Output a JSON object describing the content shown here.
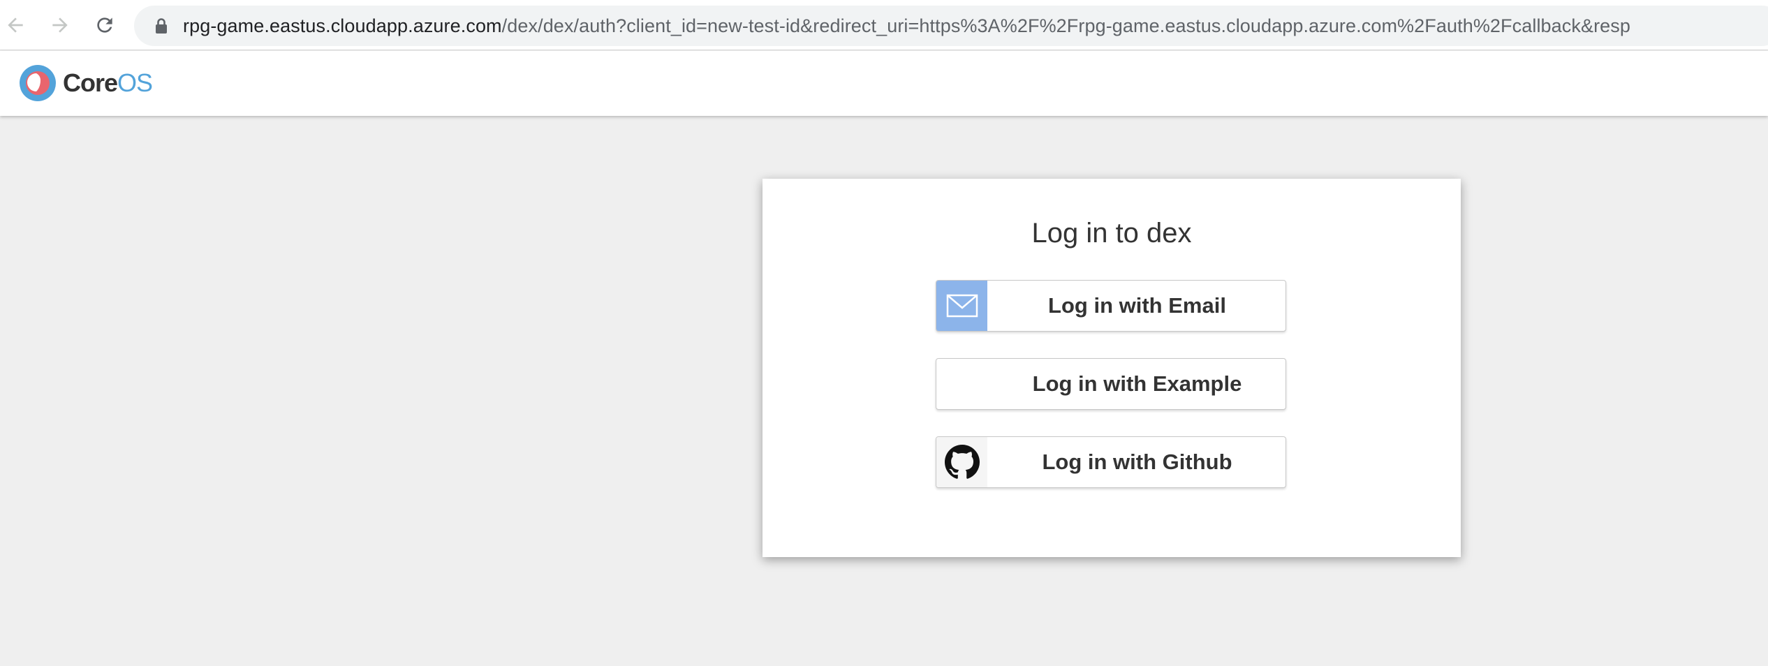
{
  "browser": {
    "url_host": "rpg-game.eastus.cloudapp.azure.com",
    "url_path": "/dex/dex/auth?client_id=new-test-id&redirect_uri=https%3A%2F%2Frpg-game.eastus.cloudapp.azure.com%2Fauth%2Fcallback&resp",
    "back_icon": "arrow-left-icon",
    "forward_icon": "arrow-right-icon",
    "reload_icon": "reload-icon",
    "lock_icon": "lock-icon"
  },
  "header": {
    "logo_core": "Core",
    "logo_os": "OS"
  },
  "login": {
    "title": "Log in to dex",
    "buttons": [
      {
        "label": "Log in with Email",
        "icon": "envelope-icon"
      },
      {
        "label": "Log in with Example",
        "icon": ""
      },
      {
        "label": "Log in with Github",
        "icon": "github-icon"
      }
    ]
  },
  "colors": {
    "page_bg": "#efefef",
    "email_icon_bg": "#8cb4ea",
    "logo_red": "#e9656d",
    "logo_blue": "#53a3da"
  }
}
